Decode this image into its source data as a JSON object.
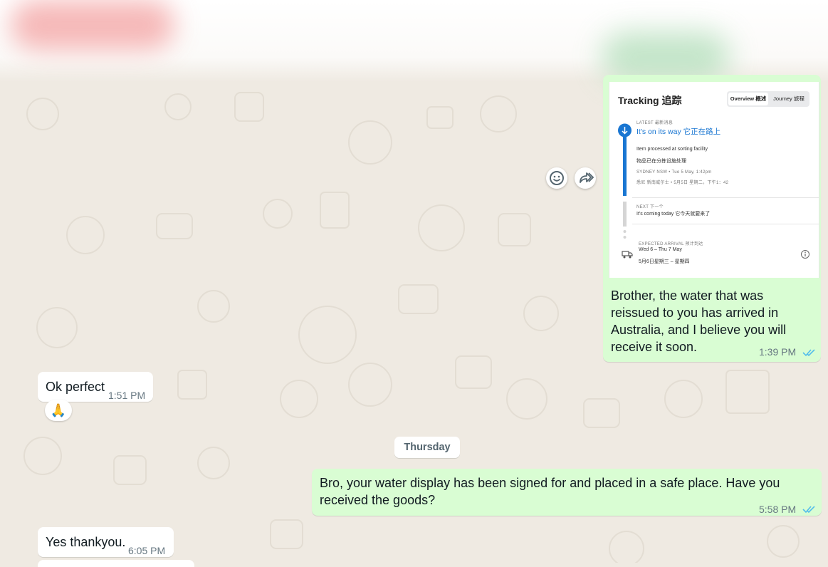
{
  "tracking_card": {
    "title": "Tracking 追踪",
    "tab_overview": "Overview 概述",
    "tab_journey": "Journey 旅程",
    "latest_label": "LATEST 最新消息",
    "latest_status": "It's on its way 它正在路上",
    "event_en": "Item processed at sorting facility",
    "event_zh": "物品已在分拣设施处理",
    "event_loc_en": "SYDNEY NSW • Tue 5 May, 1:42pm",
    "event_loc_zh": "悉尼 新南威尔士 • 5月5日 星期二，下午1：42",
    "next_label": "NEXT 下一个",
    "next_status": "It's coming today 它今天就要来了",
    "expected_label": "EXPECTED ARRIVAL 预计到达",
    "expected_en": "Wed 6 – Thu 7 May",
    "expected_zh": "5月6日星期三 – 星期四"
  },
  "messages": [
    {
      "text": "Brother, the water that was reissued to you has arrived in Australia, and I believe you will receive it soon.",
      "time": "1:39 PM",
      "direction": "outgoing"
    },
    {
      "text": "Ok perfect",
      "time": "1:51 PM",
      "direction": "incoming",
      "reaction": "🙏"
    },
    {
      "text": "Bro, your water display has been signed for and placed in a safe place. Have you received the goods?",
      "time": "5:58 PM",
      "direction": "outgoing"
    },
    {
      "text": "Yes thankyou.",
      "time": "6:05 PM",
      "direction": "incoming"
    }
  ],
  "date_separator": "Thursday",
  "colors": {
    "outgoing_bubble": "#d9fdd3",
    "incoming_bubble": "#ffffff",
    "read_ticks": "#53bdeb",
    "background": "#efeae2"
  },
  "hover_actions": {
    "react_icon": "smiley-icon",
    "forward_icon": "forward-icon"
  }
}
